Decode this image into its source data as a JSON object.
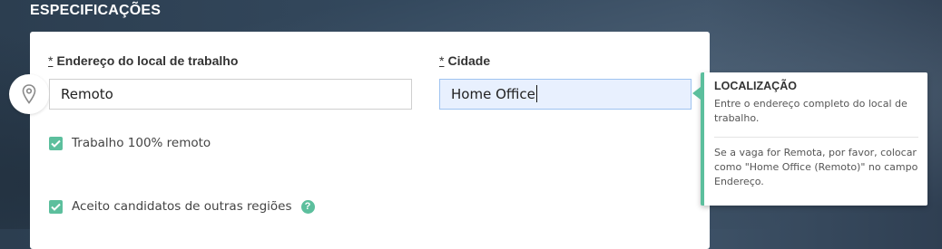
{
  "section": {
    "title": "ESPECIFICAÇÕES"
  },
  "address_field": {
    "required_mark": "*",
    "label": "Endereço do local de trabalho",
    "value": "Remoto",
    "icon": "map-pin-icon"
  },
  "city_field": {
    "required_mark": "*",
    "label": "Cidade",
    "value": "Home Office"
  },
  "checkboxes": [
    {
      "label": "Trabalho 100% remoto",
      "checked": true
    },
    {
      "label": "Aceito candidatos de outras regiões",
      "checked": true,
      "help_icon": "question-icon"
    }
  ],
  "tooltip": {
    "title": "LOCALIZAÇÃO",
    "text1": "Entre o endereço completo do local de trabalho.",
    "text2": "Se a vaga for Remota, por favor, colocar como \"Home Office (Remoto)\" no campo Endereço."
  },
  "colors": {
    "accent": "#5cbf9d",
    "focus_bg": "#e8f0fe",
    "header_bg": "#2c3e50"
  }
}
